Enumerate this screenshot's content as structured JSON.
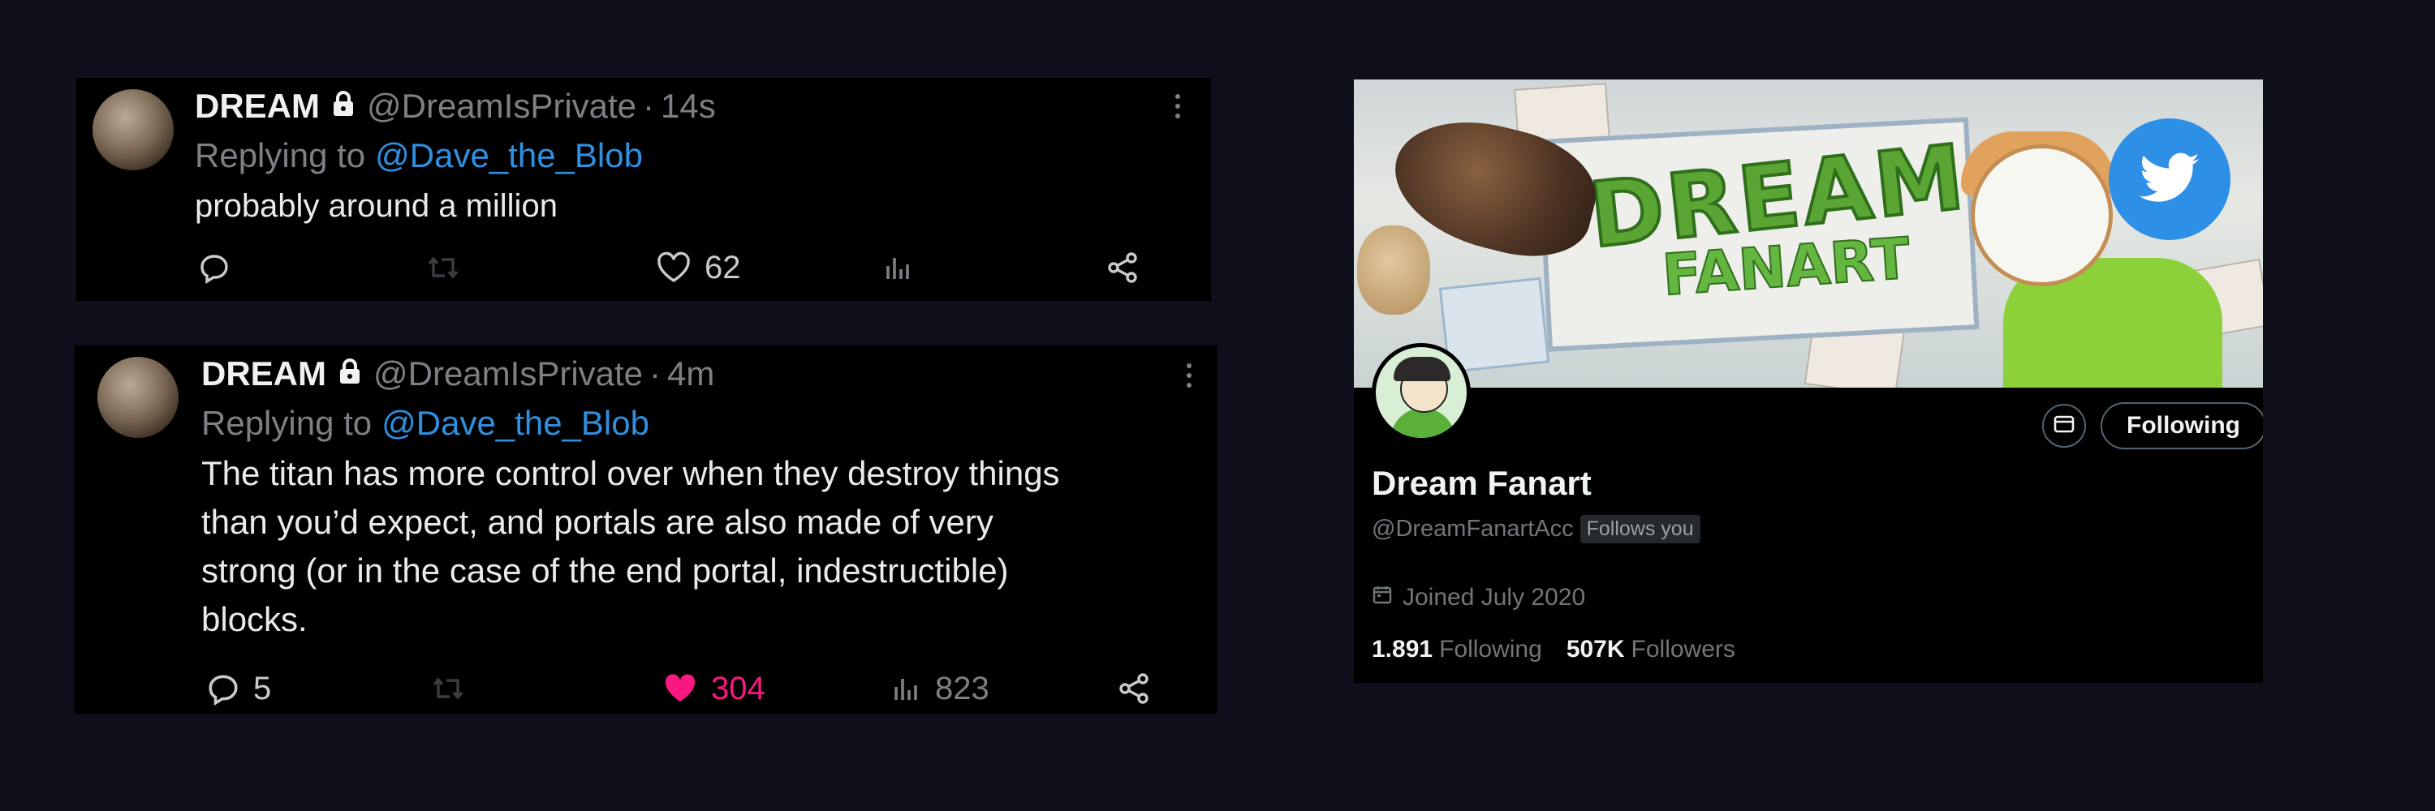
{
  "tweets": [
    {
      "display_name": "DREAM",
      "handle": "@DreamIsPrivate",
      "separator": "·",
      "time": "14s",
      "replying_to_label": "Replying to",
      "replying_to_handle": "@Dave_the_Blob",
      "text": "probably around a million",
      "actions": {
        "reply_count": "",
        "retweet_count": "",
        "like_count": "62",
        "views_count": "",
        "liked": false
      }
    },
    {
      "display_name": "DREAM",
      "handle": "@DreamIsPrivate",
      "separator": "·",
      "time": "4m",
      "replying_to_label": "Replying to",
      "replying_to_handle": "@Dave_the_Blob",
      "text_lines": [
        "The titan has more control over when they destroy things",
        "than you’d expect, and portals are also made of very",
        "strong (or in the case of the end portal, indestructible)",
        "blocks."
      ],
      "actions": {
        "reply_count": "5",
        "retweet_count": "",
        "like_count": "304",
        "views_count": "823",
        "liked": true
      }
    }
  ],
  "profile": {
    "banner": {
      "art_text_line1": "DREAM",
      "art_text_line2": "FANART"
    },
    "follow_button_label": "Following",
    "name": "Dream Fanart",
    "handle": "@DreamFanartAcc",
    "follows_you_badge": "Follows you",
    "joined": "Joined July 2020",
    "following_count": "1.891",
    "following_label": "Following",
    "followers_count": "507K",
    "followers_label": "Followers"
  },
  "icons": {
    "lock": "lock-icon",
    "more": "more-vertical-icon",
    "reply": "reply-icon",
    "retweet": "retweet-icon",
    "like": "heart-icon",
    "views": "views-icon",
    "share": "share-icon",
    "mail": "mail-icon",
    "calendar": "calendar-icon",
    "twitter_logo": "twitter-bird-icon"
  },
  "colors": {
    "background": "#0f0f1b",
    "card": "#000000",
    "link": "#2f8fe0",
    "muted": "#7c8085",
    "like_active": "#f91880"
  }
}
